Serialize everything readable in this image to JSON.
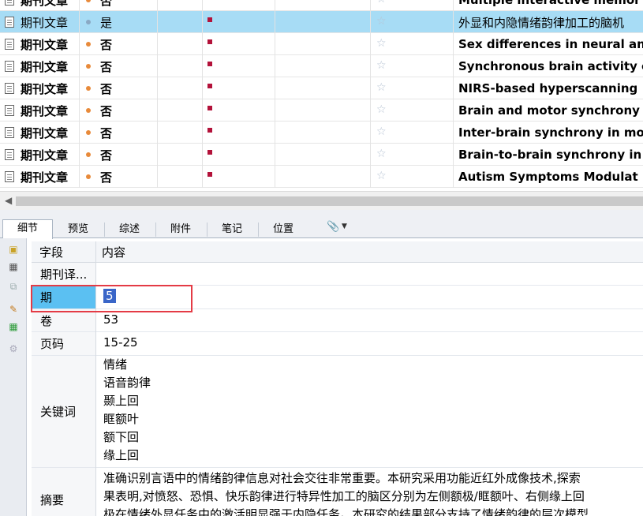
{
  "refs": [
    {
      "type": "期刊文章",
      "read": "否",
      "title": "Multiple interactive memor",
      "selected": false
    },
    {
      "type": "期刊文章",
      "read": "是",
      "title": "外显和内隐情绪韵律加工的脑机",
      "selected": true
    },
    {
      "type": "期刊文章",
      "read": "否",
      "title": "Sex differences in neural an",
      "selected": false
    },
    {
      "type": "期刊文章",
      "read": "否",
      "title": "Synchronous brain activity c",
      "selected": false
    },
    {
      "type": "期刊文章",
      "read": "否",
      "title": "NIRS-based hyperscanning",
      "selected": false
    },
    {
      "type": "期刊文章",
      "read": "否",
      "title": "Brain and motor synchrony",
      "selected": false
    },
    {
      "type": "期刊文章",
      "read": "否",
      "title": "Inter-brain synchrony in mo",
      "selected": false
    },
    {
      "type": "期刊文章",
      "read": "否",
      "title": "Brain-to-brain synchrony in",
      "selected": false
    },
    {
      "type": "期刊文章",
      "read": "否",
      "title": "Autism Symptoms Modulat",
      "selected": false
    }
  ],
  "tabs": [
    "细节",
    "预览",
    "综述",
    "附件",
    "笔记",
    "位置"
  ],
  "grid": {
    "header_field": "字段",
    "header_content": "内容",
    "journal_label": "期刊译...",
    "issue_label": "期",
    "issue_value": "5",
    "volume_label": "卷",
    "volume_value": "53",
    "pages_label": "页码",
    "pages_value": "15-25",
    "keywords_label": "关键词",
    "keywords": [
      "情绪",
      "语音韵律",
      "颞上回",
      "眶额叶",
      "额下回",
      "缘上回"
    ],
    "abstract_label": "摘要",
    "abstract_lines": [
      "准确识别言语中的情绪韵律信息对社会交往非常重要。本研究采用功能近红外成像技术,探索",
      "果表明,对愤怒、恐惧、快乐韵律进行特异性加工的脑区分别为左侧额极/眶额叶、右侧缘上回",
      "极在情绪外显任务中的激活明显强于内隐任务。本研究的结果部分支持了情绪韵律的层次模型"
    ]
  },
  "colors": {
    "selected_row": "#a7dcf5",
    "selected_field": "#5bc0f2",
    "highlight_box": "#e43b45"
  }
}
